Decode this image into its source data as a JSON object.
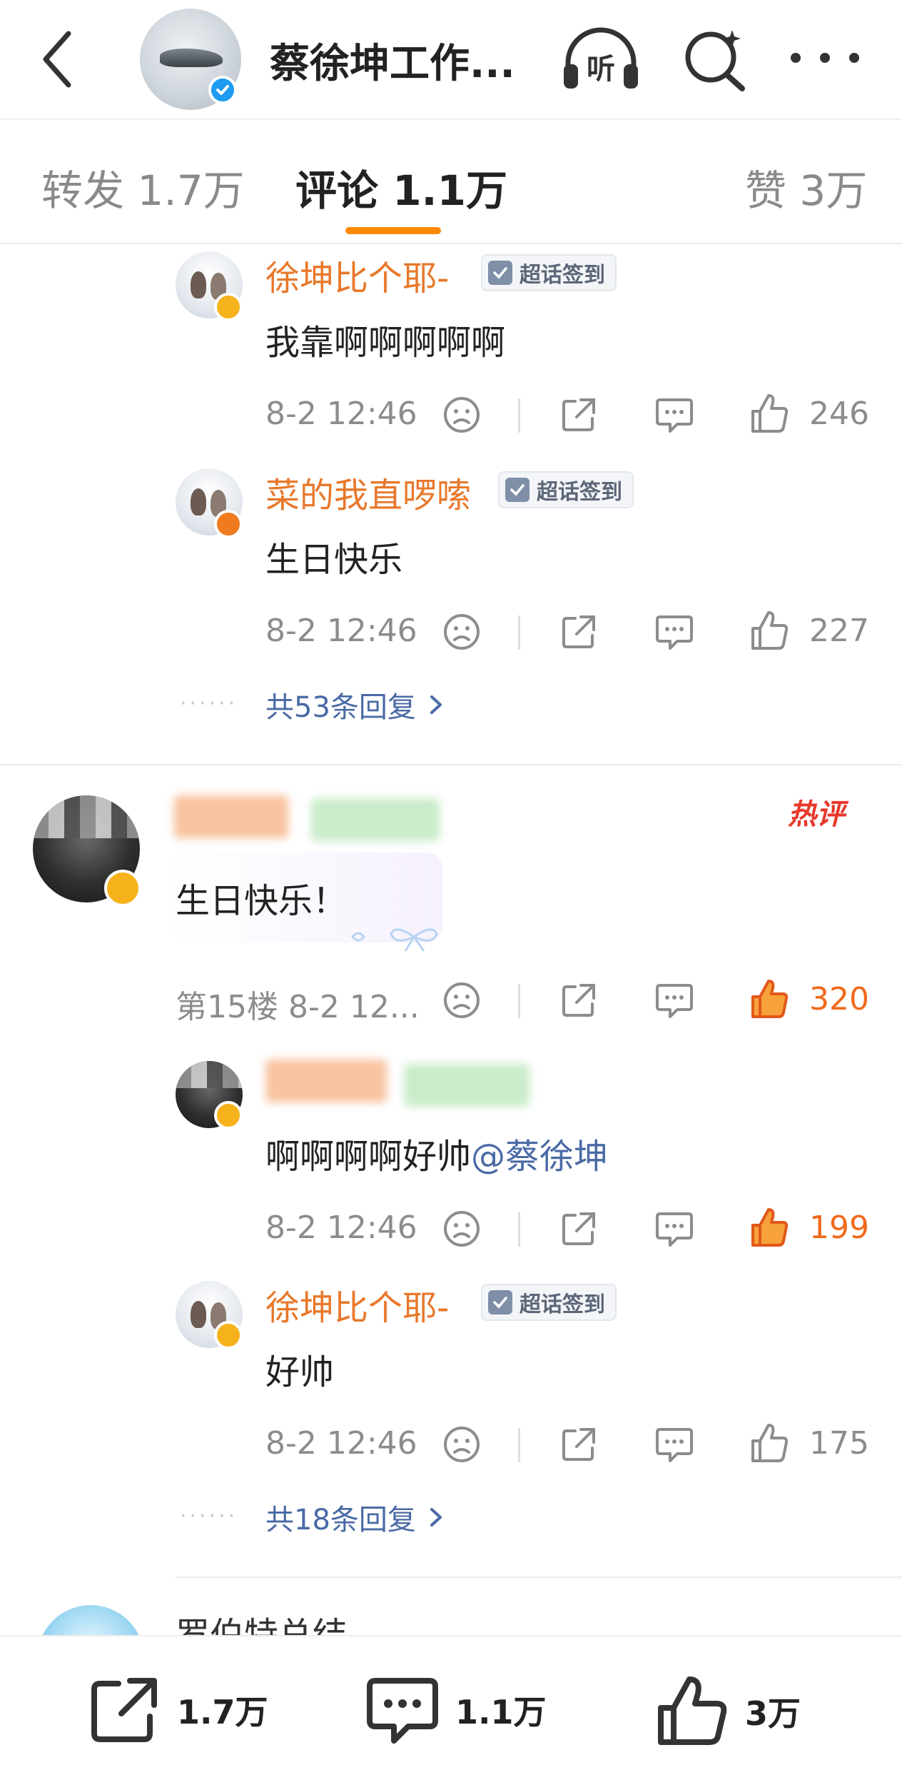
{
  "header": {
    "title": "蔡徐坤工作...",
    "listen_label": "听"
  },
  "tabs": [
    {
      "label": "转发 1.7万"
    },
    {
      "label": "评论 1.1万"
    },
    {
      "label": "赞 3万"
    }
  ],
  "tag_label": "超话签到",
  "comments": [
    {
      "user": "徐坤比个耶-",
      "text": "我靠啊啊啊啊啊",
      "time": "8-2 12:46",
      "likes": "246"
    },
    {
      "user": "菜的我直啰嗦",
      "text": "生日快乐",
      "time": "8-2 12:46",
      "likes": "227"
    },
    {
      "replies_link": "共53条回复"
    },
    {
      "text": "生日快乐！",
      "floor_time": "第15楼 8-2 12...",
      "likes": "320",
      "hot_label": "热评"
    },
    {
      "text_plain": "啊啊啊啊好帅",
      "mention": "@蔡徐坤",
      "time": "8-2 12:46",
      "likes": "199"
    },
    {
      "user": "徐坤比个耶-",
      "text": "好帅",
      "time": "8-2 12:46",
      "likes": "175"
    },
    {
      "replies_link": "共18条回复"
    },
    {
      "user": "罗伯特总结"
    }
  ],
  "bottom_bar": {
    "repost_count": "1.7万",
    "comment_count": "1.1万",
    "like_count": "3万"
  },
  "colors": {
    "username": "#e8782b",
    "accent": "#ff8a00",
    "hot_like": "#f06a1c",
    "link": "#4a6aa5"
  }
}
